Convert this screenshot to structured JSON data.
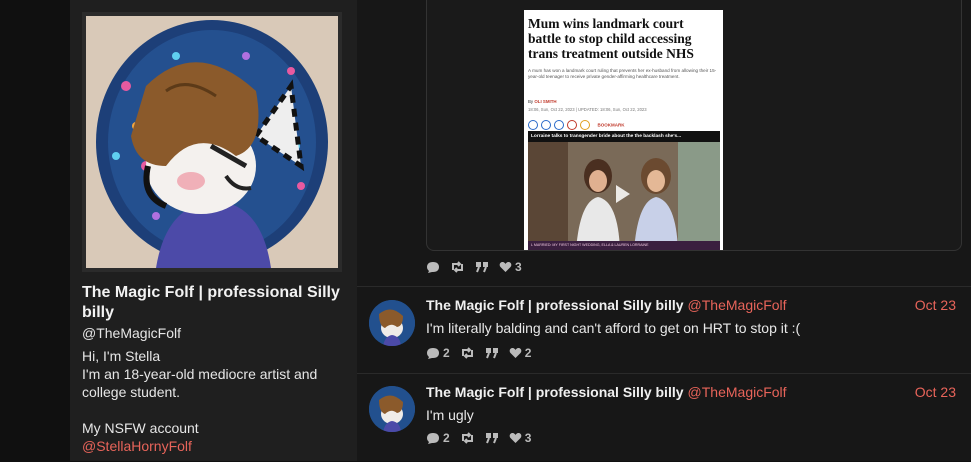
{
  "profile": {
    "display_name": "The Magic Folf | professional Silly billy",
    "handle": "@TheMagicFolf",
    "bio_lines": [
      "Hi, I'm Stella",
      "I'm an 18-year-old mediocre artist and college student.",
      "",
      "My NSFW account"
    ],
    "bio_link": "@StellaHornyFolf"
  },
  "embedded_post": {
    "article": {
      "headline": "Mum wins landmark court battle to stop child accessing trans treatment outside NHS",
      "lede": "A mum has won a landmark court ruling that prevents her ex-husband from allowing their 15-year-old teenager to receive private gender-affirming healthcare treatment.",
      "byline_prefix": "By",
      "byline_author": "OLI SMITH",
      "date": "18:06, Sun, Oct 22, 2023 | UPDATED: 18:06, Sun, Oct 22, 2023",
      "bookmark_label": "BOOKMARK",
      "video_caption": "Lorraine talks to transgender bride about the the backlash she's...",
      "video_bar": "L  MARRIED: MY FIRST NIGHT WEDDING, ELLA & LAUREN    LORRAINE"
    },
    "actions": {
      "replies": "",
      "reposts": "",
      "likes": "3"
    }
  },
  "posts": [
    {
      "name": "The Magic Folf | professional Silly billy",
      "handle": "@TheMagicFolf",
      "date": "Oct 23",
      "text": "I'm literally balding and can't afford  to get on HRT to stop it :(",
      "replies": "2",
      "likes": "2"
    },
    {
      "name": "The Magic Folf | professional Silly billy",
      "handle": "@TheMagicFolf",
      "date": "Oct 23",
      "text": "I'm ugly",
      "replies": "2",
      "likes": "3"
    }
  ],
  "icons": {
    "reply": "speech-bubble-icon",
    "repost": "repost-arrows-icon",
    "quote": "quote-marks-icon",
    "like": "heart-icon"
  },
  "colors": {
    "accent": "#e8645a",
    "background": "#171717",
    "sidebar": "#1f1f1f"
  }
}
